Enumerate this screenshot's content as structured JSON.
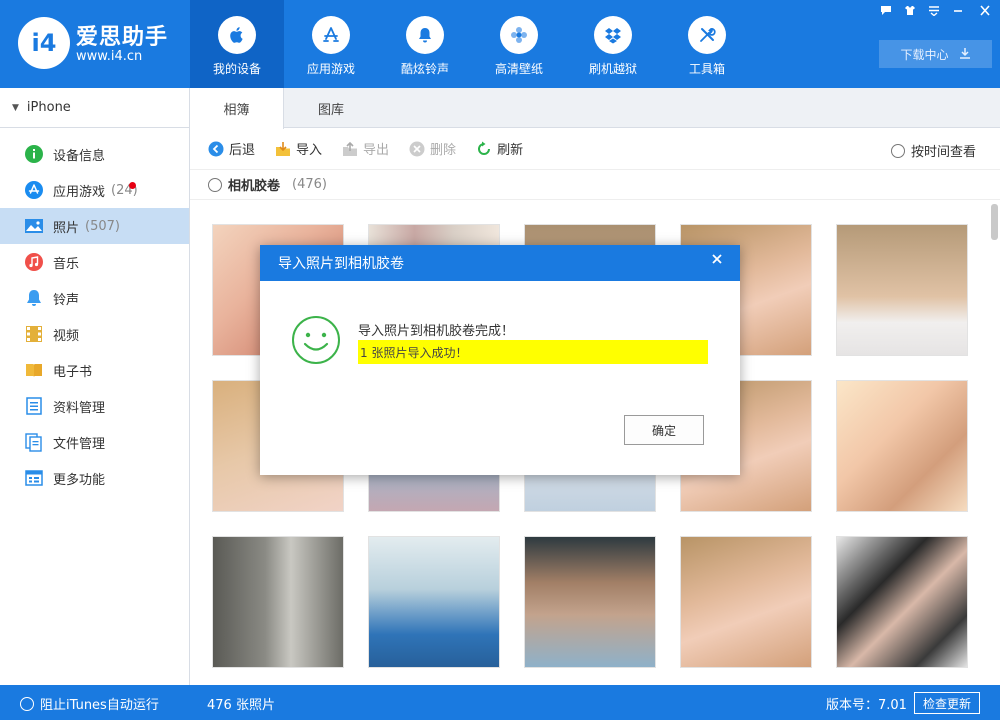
{
  "app": {
    "name": "爱思助手",
    "url": "www.i4.cn",
    "logo_mark": "i4"
  },
  "nav": [
    {
      "label": "我的设备",
      "icon": "apple-icon",
      "active": true
    },
    {
      "label": "应用游戏",
      "icon": "app-store-icon",
      "active": false
    },
    {
      "label": "酷炫铃声",
      "icon": "bell-icon",
      "active": false
    },
    {
      "label": "高清壁纸",
      "icon": "flower-icon",
      "active": false
    },
    {
      "label": "刷机越狱",
      "icon": "dropbox-icon",
      "active": false
    },
    {
      "label": "工具箱",
      "icon": "tools-icon",
      "active": false
    }
  ],
  "header": {
    "download_label": "下载中心"
  },
  "sidebar": {
    "device": "iPhone",
    "items": [
      {
        "label": "设备信息",
        "icon": "info-icon",
        "count": "",
        "badge": false,
        "active": false
      },
      {
        "label": "应用游戏",
        "icon": "app-store-icon",
        "count": "(24)",
        "badge": true,
        "active": false
      },
      {
        "label": "照片",
        "icon": "photo-icon",
        "count": "(507)",
        "badge": false,
        "active": true
      },
      {
        "label": "音乐",
        "icon": "music-icon",
        "count": "",
        "badge": false,
        "active": false
      },
      {
        "label": "铃声",
        "icon": "bell-icon",
        "count": "",
        "badge": false,
        "active": false
      },
      {
        "label": "视频",
        "icon": "video-icon",
        "count": "",
        "badge": false,
        "active": false
      },
      {
        "label": "电子书",
        "icon": "book-icon",
        "count": "",
        "badge": false,
        "active": false
      },
      {
        "label": "资料管理",
        "icon": "contacts-icon",
        "count": "",
        "badge": false,
        "active": false
      },
      {
        "label": "文件管理",
        "icon": "files-icon",
        "count": "",
        "badge": false,
        "active": false
      },
      {
        "label": "更多功能",
        "icon": "more-icon",
        "count": "",
        "badge": false,
        "active": false
      }
    ]
  },
  "tabs": [
    {
      "label": "相簿",
      "active": true
    },
    {
      "label": "图库",
      "active": false
    }
  ],
  "toolbar": {
    "back": "后退",
    "import": "导入",
    "export": "导出",
    "delete": "删除",
    "refresh": "刷新",
    "time_view": "按时间查看"
  },
  "album": {
    "name": "相机胶卷",
    "count": "(476)"
  },
  "statusbar": {
    "itunes": "阻止iTunes自动运行",
    "photo_total": "476 张照片",
    "version": "版本号：7.01",
    "update": "检查更新"
  },
  "dialog": {
    "title": "导入照片到相机胶卷",
    "message": "导入照片到相机胶卷完成！",
    "highlight": "1 张照片导入成功！",
    "ok": "确定"
  },
  "colors": {
    "brand": "#1a7ae0",
    "highlight": "#ffff00",
    "smiley": "#3cb34a"
  }
}
